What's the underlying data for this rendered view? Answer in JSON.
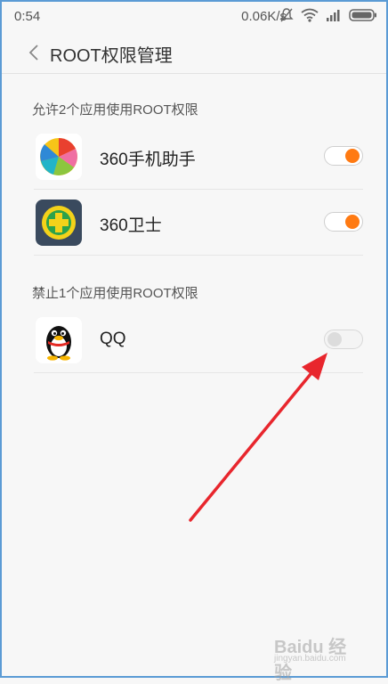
{
  "status_bar": {
    "time": "0:54",
    "network_speed": "0.06K/s",
    "icons": [
      "mute-icon",
      "wifi-icon",
      "signal-icon",
      "battery-icon"
    ]
  },
  "header": {
    "title": "ROOT权限管理"
  },
  "allowed_section": {
    "title": "允许2个应用使用ROOT权限",
    "apps": [
      {
        "name": "360手机助手",
        "icon": "360-app-store-icon",
        "root_enabled": true
      },
      {
        "name": "360卫士",
        "icon": "360-security-icon",
        "root_enabled": true
      }
    ]
  },
  "denied_section": {
    "title": "禁止1个应用使用ROOT权限",
    "apps": [
      {
        "name": "QQ",
        "icon": "qq-penguin-icon",
        "root_enabled": false
      }
    ]
  },
  "annotation": {
    "type": "arrow",
    "color": "#e8262d"
  },
  "watermark": {
    "text": "Baidu 经验",
    "subtext": "jingyan.baidu.com"
  },
  "colors": {
    "toggle_on": "#ff7a12",
    "toggle_off": "#dcdcdc",
    "frame_border": "#5b9bd5"
  }
}
